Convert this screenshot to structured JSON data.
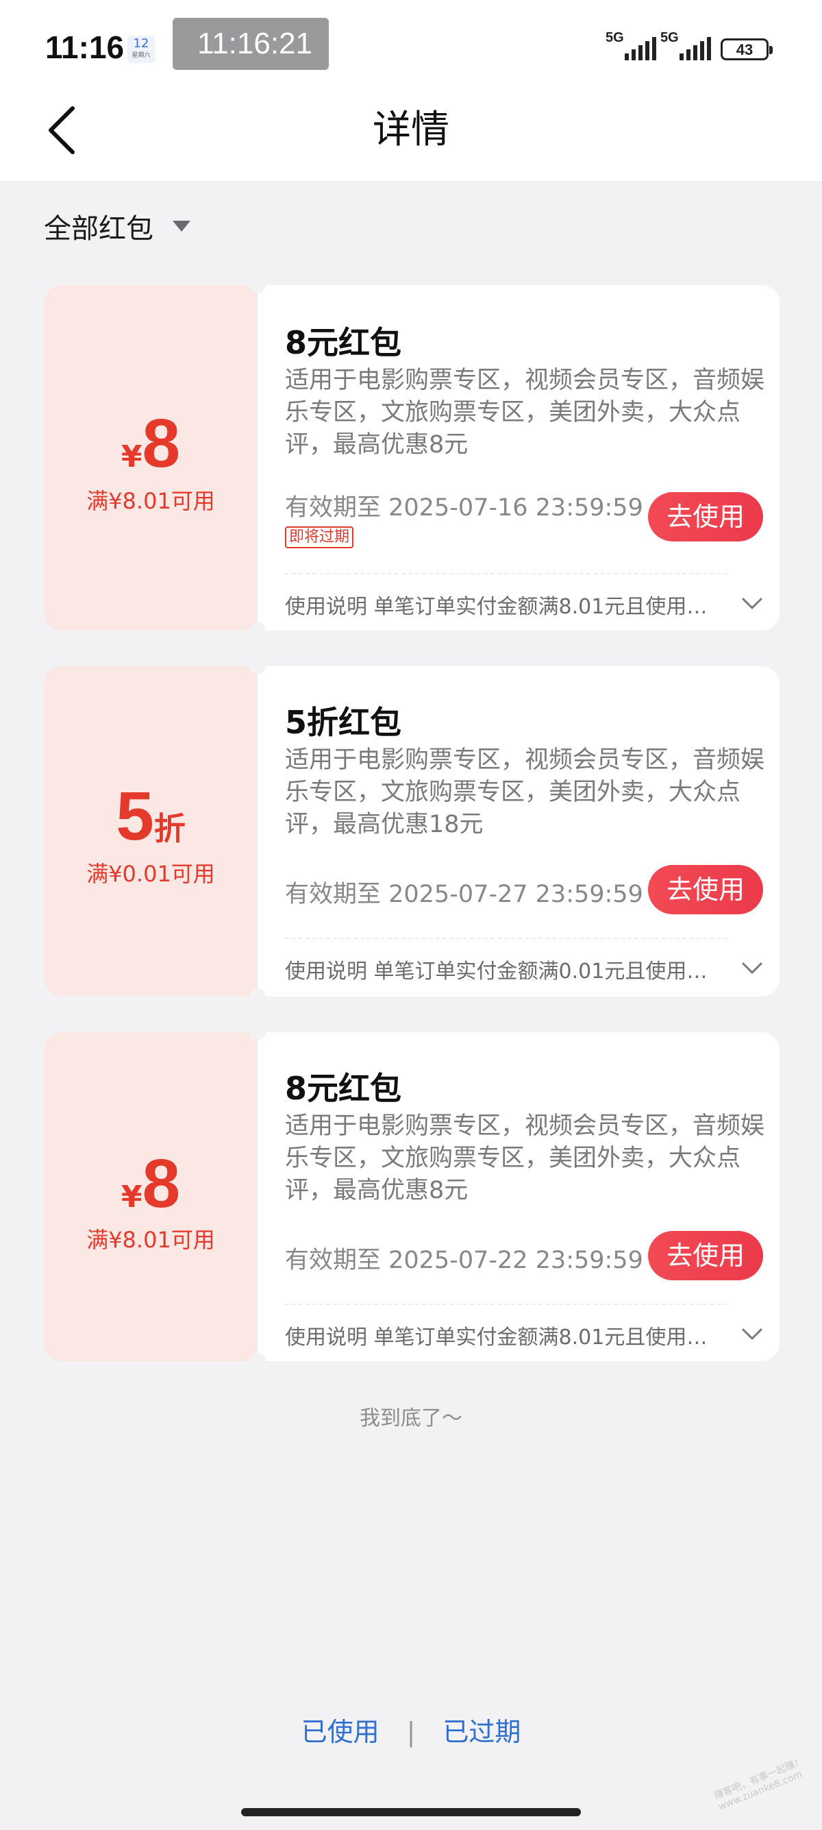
{
  "status_bar": {
    "time": "11:16",
    "calendar_day": "12",
    "calendar_sub": "星期六",
    "dots": "•••",
    "pill_time": "11:16:21",
    "network_1": "5G",
    "network_2": "5G",
    "battery": "43"
  },
  "header": {
    "title": "详情"
  },
  "filter": {
    "label": "全部红包"
  },
  "coupons": [
    {
      "currency": "¥",
      "amount": "8",
      "threshold": "满¥8.01可用",
      "title": "8元红包",
      "description": "适用于电影购票专区，视频会员专区，音频娱乐专区，文旅购票专区，美团外卖，大众点评，最高优惠8元",
      "expiry": "有效期至 2025-07-16 23:59:59",
      "tag": "即将过期",
      "button": "去使用",
      "note": "使用说明 单笔订单实付金额满8.01元且使用…"
    },
    {
      "amount": "5",
      "unit": "折",
      "threshold": "满¥0.01可用",
      "title": "5折红包",
      "description": "适用于电影购票专区，视频会员专区，音频娱乐专区，文旅购票专区，美团外卖，大众点评，最高优惠18元",
      "expiry": "有效期至 2025-07-27 23:59:59",
      "button": "去使用",
      "note": "使用说明 单笔订单实付金额满0.01元且使用…"
    },
    {
      "currency": "¥",
      "amount": "8",
      "threshold": "满¥8.01可用",
      "title": "8元红包",
      "description": "适用于电影购票专区，视频会员专区，音频娱乐专区，文旅购票专区，美团外卖，大众点评，最高优惠8元",
      "expiry": "有效期至 2025-07-22 23:59:59",
      "button": "去使用",
      "note": "使用说明 单笔订单实付金额满8.01元且使用…"
    }
  ],
  "end_text": "我到底了～",
  "footer": {
    "used": "已使用",
    "separator": "|",
    "expired": "已过期"
  },
  "watermark": "赚客吧，有事一起赚！www.zuanke8.com",
  "colors": {
    "accent": "#e4392b",
    "button": "#f24a55",
    "link": "#2f6fd0",
    "left_panel": "#fbe8e4"
  }
}
